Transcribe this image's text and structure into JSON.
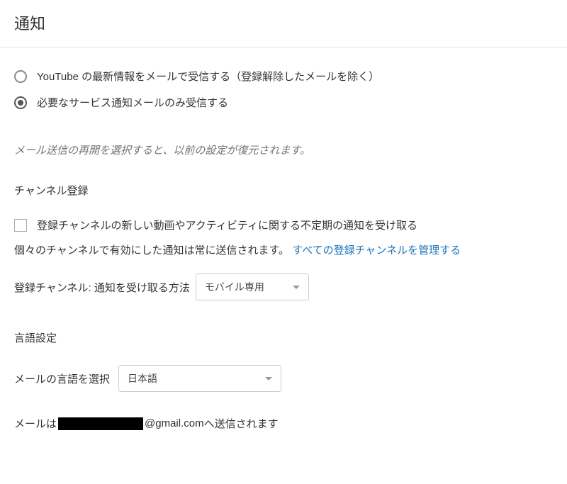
{
  "page_title": "通知",
  "email_prefs": {
    "option1": {
      "label": "YouTube の最新情報をメールで受信する（登録解除したメールを除く）",
      "selected": false
    },
    "option2": {
      "label": "必要なサービス通知メールのみ受信する",
      "selected": true
    },
    "note": "メール送信の再開を選択すると、以前の設定が復元されます。"
  },
  "subscriptions": {
    "header": "チャンネル登録",
    "checkbox_label": "登録チャンネルの新しい動画やアクティビティに関する不定期の通知を受け取る",
    "description": "個々のチャンネルで有効にした通知は常に送信されます。",
    "manage_link": "すべての登録チャンネルを管理する",
    "method_label": "登録チャンネル: 通知を受け取る方法",
    "method_value": "モバイル専用"
  },
  "language": {
    "header": "言語設定",
    "label": "メールの言語を選択",
    "value": "日本語"
  },
  "email_sent": {
    "prefix": "メールは",
    "domain": "@gmail.com",
    "suffix": " へ送信されます"
  }
}
